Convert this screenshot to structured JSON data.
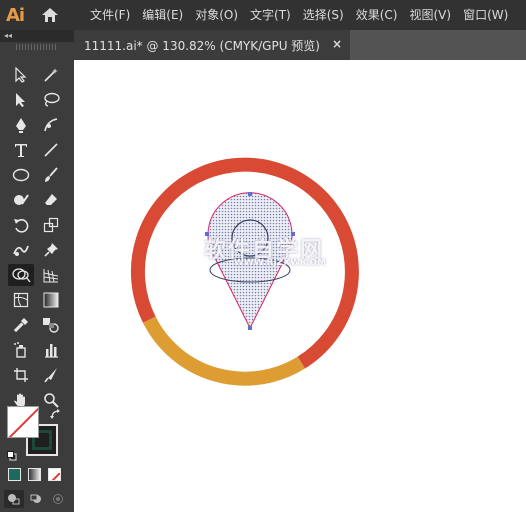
{
  "app": {
    "logo": "Ai",
    "home_icon": "home-icon",
    "menu": [
      "文件(F)",
      "编辑(E)",
      "对象(O)",
      "文字(T)",
      "选择(S)",
      "效果(C)",
      "视图(V)",
      "窗口(W)"
    ]
  },
  "panel": {
    "collapse_label": "◂◂"
  },
  "document": {
    "tab_title": "11111.ai* @ 130.82% (CMYK/GPU 预览)",
    "close_label": "×"
  },
  "artwork": {
    "ring_red_color": "#d94a34",
    "ring_orange_color": "#de9d32",
    "pin_fill": "#c8cde0",
    "selection_color": "#e0245e",
    "watermark_main": "软件自学网",
    "watermark_sub": "WWW.RJZXW.COM"
  },
  "tools": {
    "fill_color": "#ffffff",
    "stroke_color": "#1b4a3c",
    "swatches": [
      "#1b6a5a",
      "#9a9a9a",
      "none"
    ]
  }
}
